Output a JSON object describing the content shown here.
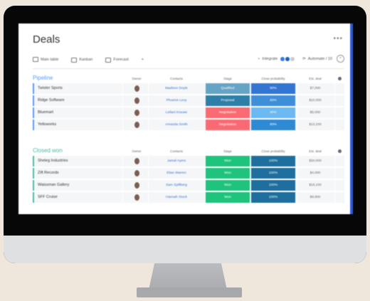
{
  "page": {
    "title": "Deals",
    "more_icon": "more-dots-icon"
  },
  "tabs": [
    {
      "label": "Main table",
      "icon": "table-icon",
      "active": true
    },
    {
      "label": "Kanban",
      "icon": "kanban-icon",
      "active": false
    },
    {
      "label": "Forecast",
      "icon": "chart-icon",
      "active": false
    },
    {
      "label": "+",
      "icon": "plus-icon",
      "active": false
    }
  ],
  "toolbar": {
    "integrate_label": "Integrate",
    "automate_label": "Automate / 10",
    "collapse_icon": "chevron-up-icon"
  },
  "columns": [
    "Owner",
    "Contacts",
    "Stage",
    "Close probability",
    "Est. deal"
  ],
  "groups": [
    {
      "title": "Pipeline",
      "color": "#579bfc",
      "rows": [
        {
          "name": "Twister Sports",
          "contact": "Madison Doyle",
          "stage": "Qualified",
          "stage_color": "#66a4c6",
          "prob": "80%",
          "prob_color": "#3275d3",
          "deal": "$7,000"
        },
        {
          "name": "Ridge Software",
          "contact": "Phoenix Levy",
          "stage": "Proposal",
          "stage_color": "#2e7fa7",
          "prob": "60%",
          "prob_color": "#3f8ed9",
          "deal": "$10,000"
        },
        {
          "name": "Bluemart",
          "contact": "Leilani Krause",
          "stage": "Negotiation",
          "stage_color": "#fa6a73",
          "prob": "40%",
          "prob_color": "#6cb8f1",
          "deal": "$5,000"
        },
        {
          "name": "Yelloworks",
          "contact": "Amanda Smith",
          "stage": "Negotiation",
          "stage_color": "#fa6a73",
          "prob": "80%",
          "prob_color": "#2f8ad4",
          "deal": "$13,200"
        }
      ]
    },
    {
      "title": "Closed won",
      "color": "#4fb8a8",
      "rows": [
        {
          "name": "Sheleg Industries",
          "contact": "Jamal Ayers",
          "stage": "Won",
          "stage_color": "#1fc47c",
          "prob": "100%",
          "prob_color": "#1e6f9d",
          "deal": "$34,000"
        },
        {
          "name": "Zift Records",
          "contact": "Elian Warren",
          "stage": "Won",
          "stage_color": "#1fc47c",
          "prob": "100%",
          "prob_color": "#1e6f9d",
          "deal": "$4,000"
        },
        {
          "name": "Waissman Gallery",
          "contact": "Sam Spillberg",
          "stage": "Won",
          "stage_color": "#1fc47c",
          "prob": "100%",
          "prob_color": "#1e6f9d",
          "deal": "$18,100"
        },
        {
          "name": "SFF Cruise",
          "contact": "Hannah Stock",
          "stage": "Won",
          "stage_color": "#1fc47c",
          "prob": "100%",
          "prob_color": "#1e6f9d",
          "deal": "$9,800"
        }
      ]
    }
  ]
}
